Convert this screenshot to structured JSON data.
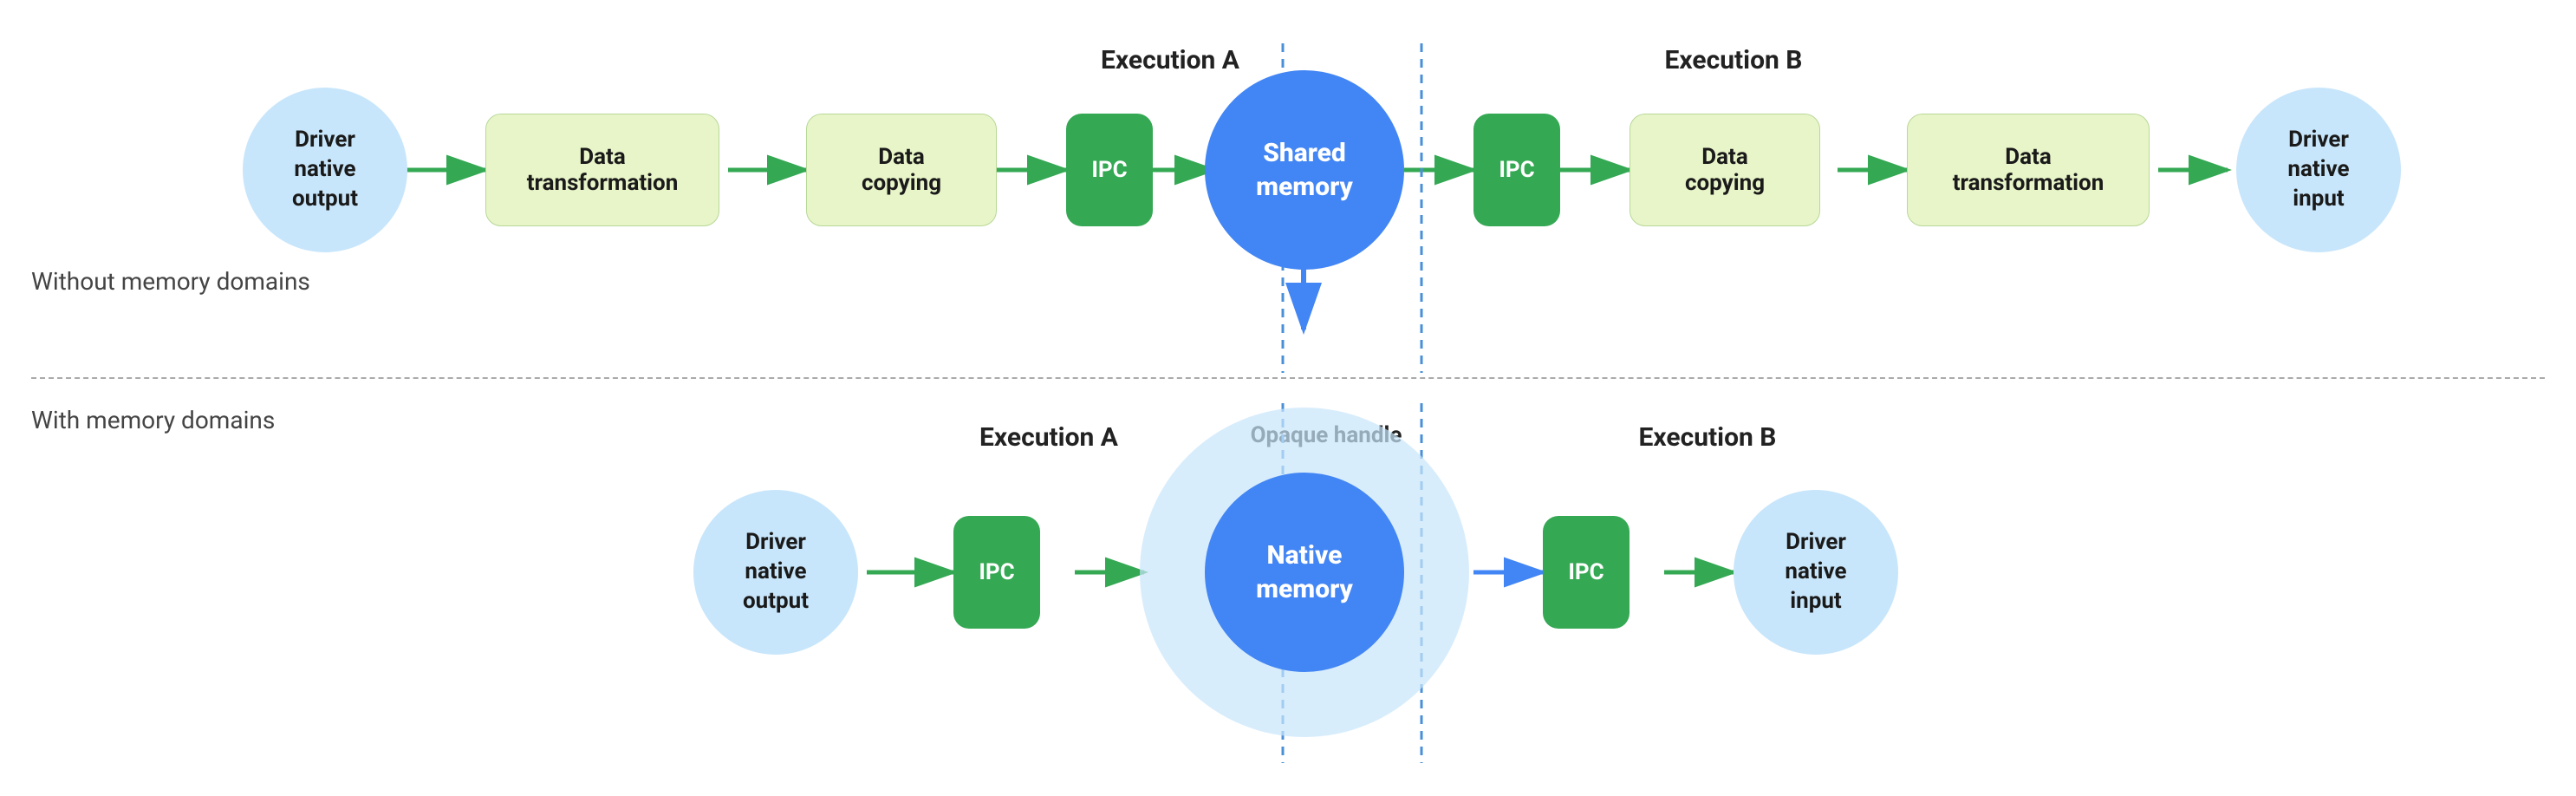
{
  "section_labels": {
    "without": "Without memory domains",
    "with": "With memory domains"
  },
  "top_row": {
    "exec_a_label": "Execution A",
    "exec_b_label": "Execution B",
    "nodes": [
      {
        "id": "top_driver_out",
        "text": "Driver\nnative\noutput",
        "type": "circle",
        "style": "light-blue"
      },
      {
        "id": "top_data_transform1",
        "text": "Data\ntransformation",
        "type": "rect",
        "style": "light-green"
      },
      {
        "id": "top_data_copy1",
        "text": "Data\ncopying",
        "type": "rect",
        "style": "light-green"
      },
      {
        "id": "top_ipc1",
        "text": "IPC",
        "type": "rect",
        "style": "green"
      },
      {
        "id": "top_shared_mem",
        "text": "Shared\nmemory",
        "type": "circle",
        "style": "blue"
      },
      {
        "id": "top_ipc2",
        "text": "IPC",
        "type": "rect",
        "style": "green"
      },
      {
        "id": "top_data_copy2",
        "text": "Data\ncopying",
        "type": "rect",
        "style": "light-green"
      },
      {
        "id": "top_data_transform2",
        "text": "Data\ntransformation",
        "type": "rect",
        "style": "light-green"
      },
      {
        "id": "top_driver_in",
        "text": "Driver\nnative\ninput",
        "type": "circle",
        "style": "light-blue"
      }
    ]
  },
  "bottom_row": {
    "exec_a_label": "Execution A",
    "exec_b_label": "Execution B",
    "opaque_label": "Opaque handle",
    "nodes": [
      {
        "id": "bot_driver_out",
        "text": "Driver\nnative\noutput",
        "type": "circle",
        "style": "light-blue"
      },
      {
        "id": "bot_ipc1",
        "text": "IPC",
        "type": "rect",
        "style": "green"
      },
      {
        "id": "bot_native_mem_bg",
        "text": "",
        "type": "circle",
        "style": "light-blue-outer"
      },
      {
        "id": "bot_native_mem",
        "text": "Native\nmemory",
        "type": "circle",
        "style": "blue"
      },
      {
        "id": "bot_ipc2",
        "text": "IPC",
        "type": "rect",
        "style": "green"
      },
      {
        "id": "bot_driver_in",
        "text": "Driver\nnative\ninput",
        "type": "circle",
        "style": "light-blue"
      }
    ]
  },
  "colors": {
    "green": "#34a853",
    "blue": "#4285f4",
    "light_blue": "#c8e6fb",
    "light_green": "#e8f5c8",
    "arrow_green": "#34a853",
    "arrow_blue": "#4285f4",
    "dashed_line": "#aaa",
    "vert_dot": "#4a90d9"
  }
}
